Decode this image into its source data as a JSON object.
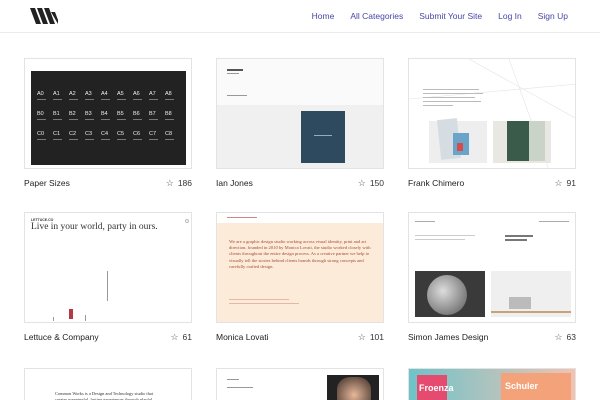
{
  "nav": {
    "home": "Home",
    "categories": "All Categories",
    "submit": "Submit Your Site",
    "login": "Log In",
    "signup": "Sign Up"
  },
  "cards": [
    {
      "title": "Paper Sizes",
      "stars": "186"
    },
    {
      "title": "Ian Jones",
      "stars": "150"
    },
    {
      "title": "Frank Chimero",
      "stars": "91"
    },
    {
      "title": "Lettuce & Company",
      "stars": "61"
    },
    {
      "title": "Monica Lovati",
      "stars": "101"
    },
    {
      "title": "Simon James Design",
      "stars": "63"
    }
  ],
  "thumbs": {
    "paper": {
      "cells": [
        "A0",
        "A1",
        "A2",
        "A3",
        "A4",
        "A5",
        "A6",
        "A7",
        "A8",
        "B0",
        "B1",
        "B2",
        "B3",
        "B4",
        "B5",
        "B6",
        "B7",
        "B8",
        "C0",
        "C1",
        "C2",
        "C3",
        "C4",
        "C5",
        "C6",
        "C7",
        "C8"
      ]
    },
    "lettuce": {
      "brand": "LETTUCE.CO",
      "headline": "Live in your world, party in ours."
    },
    "monica": {
      "text": "We are a graphic design studio working across visual identity, print and art direction, founded in 2010 by Monica Lovati, the studio worked closely with clients throughout the entire design process. As a creative partner we help to visually tell the stories behind clients brands through strong concepts and carefully crafted design."
    },
    "bottom": {
      "common": "Common Works is a Design and Technology studio that creates meaningful, lasting experiences through playful interactions and",
      "frame1": "Froenza",
      "frame2": "Schuler"
    }
  }
}
